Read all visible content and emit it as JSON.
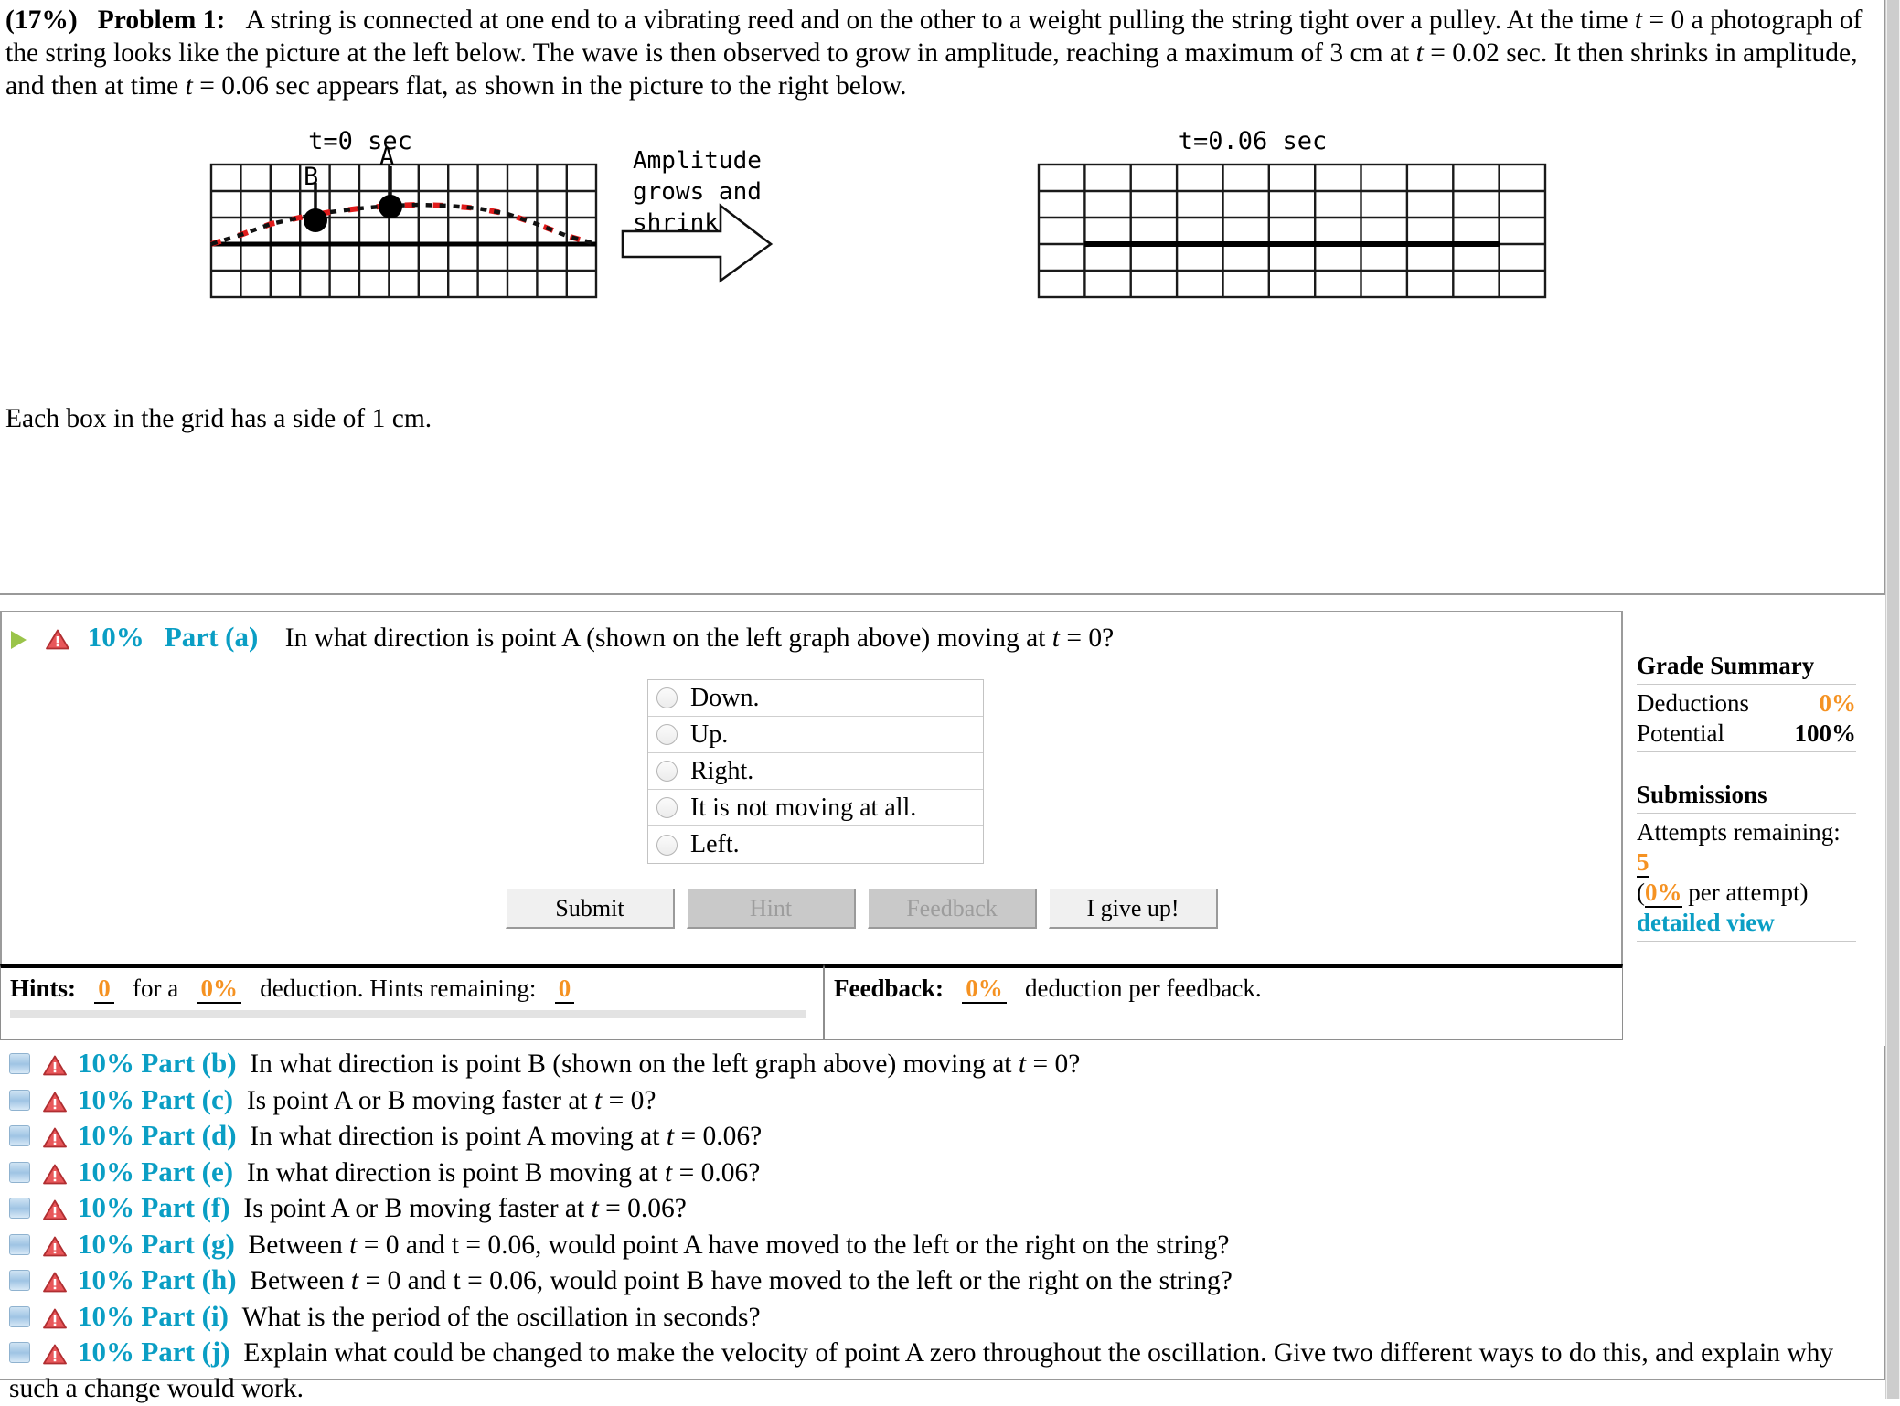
{
  "problem": {
    "weight": "(17%)",
    "title": "Problem 1:",
    "line1_a": "A string is connected at one end to a vibrating reed and on the other to a weight pulling the string tight over a pulley. At the time ",
    "t_var": "t",
    "line1_b": " = 0 a photograph of the string looks like the picture at the left below. The wave is then observed to grow in amplitude, reaching a maximum of 3 cm at ",
    "line1_c": " = 0.02 sec. It then shrinks in amplitude, and then at time ",
    "line1_d": " = 0.06 sec appears flat, as shown in the picture to the right below.",
    "note": "Each box in the grid has a side of 1 cm."
  },
  "figure": {
    "left_caption": "t=0 sec",
    "right_caption": "t=0.06 sec",
    "point_a_label": "A",
    "point_b_label": "B",
    "arrow_text_line1": "Amplitude",
    "arrow_text_line2": "grows and",
    "arrow_text_line3": "shrinks",
    "grid_box_cm": 1
  },
  "part_a": {
    "percent": "10%",
    "label": "Part (a)",
    "question_pre": "In what direction is point A (shown on the left graph above) moving at ",
    "question_var": "t",
    "question_post": " = 0?",
    "choices": [
      {
        "label": "Down.",
        "selected": false
      },
      {
        "label": "Up.",
        "selected": false
      },
      {
        "label": "Right.",
        "selected": false
      },
      {
        "label": "It is not moving at all.",
        "selected": false
      },
      {
        "label": "Left.",
        "selected": false
      }
    ],
    "buttons": [
      {
        "label": "Submit",
        "enabled": true
      },
      {
        "label": "Hint",
        "enabled": false
      },
      {
        "label": "Feedback",
        "enabled": false
      },
      {
        "label": "I give up!",
        "enabled": true
      }
    ]
  },
  "hints_bar": {
    "hints_label": "Hints:",
    "hints_count": "0",
    "for_a": "for a",
    "hints_deduction": "0%",
    "deduction_text": "deduction. Hints remaining:",
    "hints_remaining": "0",
    "feedback_label": "Feedback:",
    "feedback_deduction": "0%",
    "feedback_text": "deduction per feedback."
  },
  "grade_summary": {
    "title": "Grade Summary",
    "rows": [
      {
        "name": "Deductions",
        "value": "0%",
        "accent": true
      },
      {
        "name": "Potential",
        "value": "100%",
        "accent": false
      }
    ],
    "submissions_title": "Submissions",
    "attempts_label": "Attempts remaining:",
    "attempts_value": "5",
    "per_attempt_value": "0%",
    "per_attempt_text": "per attempt)",
    "detailed_view": "detailed view"
  },
  "parts_list": [
    {
      "percent": "10%",
      "label": "Part (b)",
      "pre": "In what direction is point B (shown on the left graph above) moving at ",
      "var": "t",
      "post": " = 0?"
    },
    {
      "percent": "10%",
      "label": "Part (c)",
      "pre": "Is point A or B moving faster at ",
      "var": "t",
      "post": " = 0?"
    },
    {
      "percent": "10%",
      "label": "Part (d)",
      "pre": "In what direction is point A moving at ",
      "var": "t",
      "post": " = 0.06?"
    },
    {
      "percent": "10%",
      "label": "Part (e)",
      "pre": "In what direction is point B moving at ",
      "var": "t",
      "post": " = 0.06?"
    },
    {
      "percent": "10%",
      "label": "Part (f)",
      "pre": "Is point A or B moving faster at ",
      "var": "t",
      "post": " = 0.06?"
    },
    {
      "percent": "10%",
      "label": "Part (g)",
      "pre": "Between ",
      "var": "t",
      "post": " = 0 and t = 0.06, would point A have moved to the left or the right on the string?"
    },
    {
      "percent": "10%",
      "label": "Part (h)",
      "pre": "Between ",
      "var": "t",
      "post": " = 0 and t = 0.06, would point B have moved to the left or the right on the string?"
    },
    {
      "percent": "10%",
      "label": "Part (i)",
      "pre": "What is the period of the oscillation in seconds?",
      "var": "",
      "post": ""
    },
    {
      "percent": "10%",
      "label": "Part (j)",
      "pre": "Explain what could be changed to make the velocity of point A zero throughout the oscillation. Give two different ways to do this, and explain why such a change would work.",
      "var": "",
      "post": ""
    }
  ],
  "colors": {
    "accent_blue": "#0a9ec4",
    "accent_orange": "#f59222",
    "warn_red": "#d4373a",
    "green": "#9ac44a",
    "curve_red": "#e01b1b"
  }
}
